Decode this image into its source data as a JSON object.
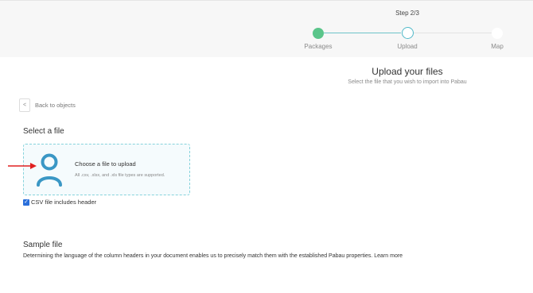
{
  "stepper": {
    "step_indicator": "Step 2/3",
    "steps": [
      {
        "label": "Packages",
        "state": "done"
      },
      {
        "label": "Upload",
        "state": "current"
      },
      {
        "label": "Map",
        "state": "todo"
      }
    ]
  },
  "header": {
    "title": "Upload your files",
    "subtitle": "Select the file that you wish to import into Pabau"
  },
  "back_link": {
    "icon": "chevron-left-icon",
    "label": "Back to objects"
  },
  "select_file": {
    "heading": "Select a file",
    "dropzone": {
      "icon": "user-icon",
      "title": "Choose a file to upload",
      "hint": "All .csv, .xlsx, and .xls file types are supported."
    },
    "csv_header_checkbox": {
      "checked": true,
      "label": "CSV file includes header"
    }
  },
  "sample_file": {
    "heading": "Sample file",
    "description": "Determining the language of the column headers in your document enables us to precisely match them with the established Pabau properties.",
    "learn_more": "Learn more"
  },
  "colors": {
    "done": "#5ac58a",
    "accent": "#4fb8c8",
    "checkbox": "#2a6fdb",
    "annotation_arrow": "#e02020"
  }
}
